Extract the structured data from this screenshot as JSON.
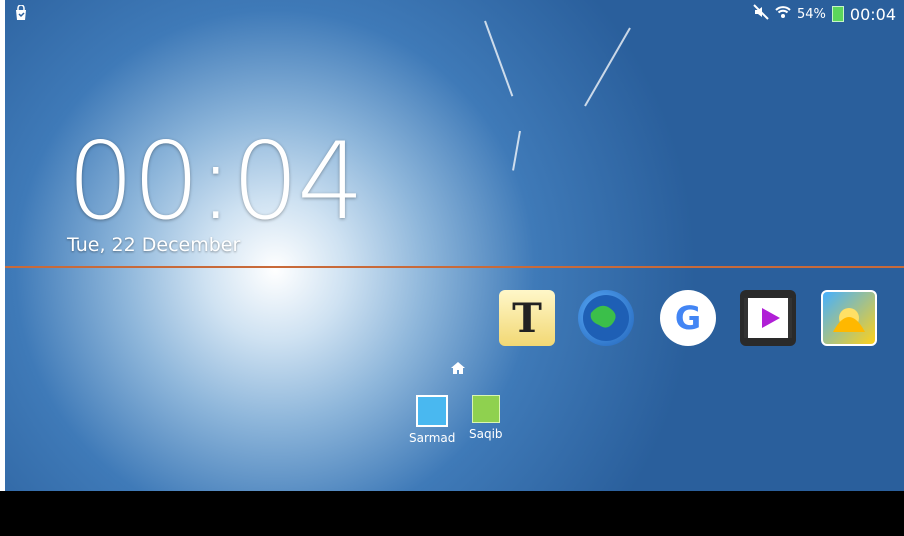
{
  "status_bar": {
    "battery_percent": "54%",
    "time": "00:04",
    "icons": [
      "mute-icon",
      "wifi-icon",
      "battery-icon",
      "shopping-bag-icon"
    ]
  },
  "lockscreen": {
    "clock": "00:04",
    "date": "Tue, 22 December"
  },
  "apps": [
    {
      "name": "text-app",
      "icon": "T"
    },
    {
      "name": "globe-app",
      "icon": "globe-icon"
    },
    {
      "name": "google-app",
      "icon": "G"
    },
    {
      "name": "video-app",
      "icon": "video-icon"
    },
    {
      "name": "gallery-app",
      "icon": "gallery-icon"
    }
  ],
  "contacts": [
    {
      "label": "Sarmad"
    },
    {
      "label": "Saqib"
    }
  ],
  "colors": {
    "wallpaper_blue": "#2a5f9c",
    "divider": "#c86a3a",
    "battery_green": "#5cd65c"
  }
}
